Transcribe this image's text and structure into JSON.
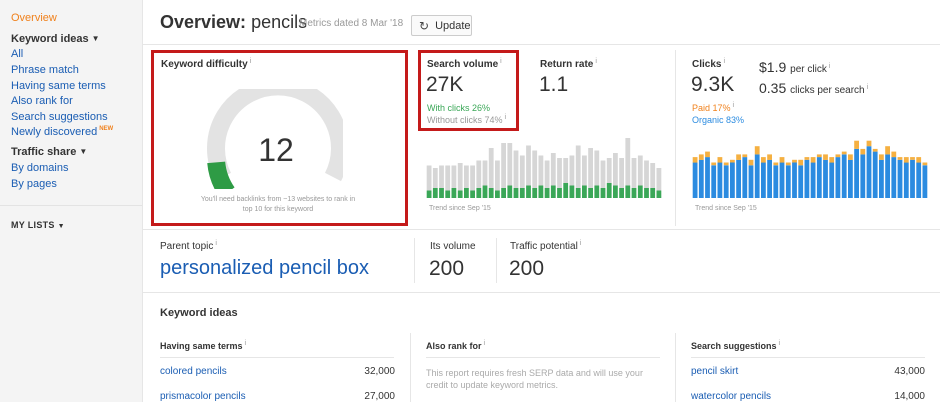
{
  "sidebar": {
    "overview": "Overview",
    "keyword_ideas": "Keyword ideas",
    "links": [
      "All",
      "Phrase match",
      "Having same terms",
      "Also rank for",
      "Search suggestions",
      "Newly discovered"
    ],
    "new_badge": "NEW",
    "traffic_share": "Traffic share",
    "traffic_links": [
      "By domains",
      "By pages"
    ],
    "my_lists": "MY LISTS"
  },
  "header": {
    "title": "Overview:",
    "keyword": "pencils",
    "metrics_date": "Metrics dated 8 Mar '18",
    "update_label": "Update"
  },
  "difficulty": {
    "label": "Keyword difficulty",
    "value": "12",
    "level": 0.12,
    "note": "You'll need backlinks from ~13 websites to rank in top 10 for this keyword"
  },
  "volume": {
    "label": "Search volume",
    "value": "27K",
    "with_clicks": "With clicks 26%",
    "without_clicks": "Without clicks 74%",
    "trend": "Trend since Sep '15"
  },
  "return_rate": {
    "label": "Return rate",
    "value": "1.1"
  },
  "clicks": {
    "label": "Clicks",
    "value": "9.3K",
    "paid": "Paid 17%",
    "organic": "Organic 83%",
    "cpc_value": "$1.9",
    "cpc_unit": "per click",
    "cps_value": "0.35",
    "cps_unit": "clicks per search",
    "trend": "Trend since Sep '15"
  },
  "parent_topic": {
    "label": "Parent topic",
    "value": "personalized pencil box",
    "its_volume_label": "Its volume",
    "its_volume": "200",
    "traffic_potential_label": "Traffic potential",
    "traffic_potential": "200"
  },
  "keyword_ideas": {
    "title": "Keyword ideas",
    "same_terms": {
      "head": "Having same terms",
      "rows": [
        {
          "kw": "colored pencils",
          "vol": "32,000"
        },
        {
          "kw": "prismacolor pencils",
          "vol": "27,000"
        }
      ]
    },
    "also_rank": {
      "head": "Also rank for",
      "note": "This report requires fresh SERP data and will use your credit to update keyword metrics."
    },
    "suggestions": {
      "head": "Search suggestions",
      "rows": [
        {
          "kw": "pencil skirt",
          "vol": "43,000"
        },
        {
          "kw": "watercolor pencils",
          "vol": "14,000"
        }
      ]
    }
  },
  "colors": {
    "accent": "#f0811c",
    "link": "#1a5db3",
    "green": "#3aa757",
    "grey_bar": "#d6d6d6",
    "blue_bar": "#2b8be0",
    "orange_bar": "#f5b041",
    "highlight": "#c41a1a"
  },
  "chart_data": [
    {
      "type": "bar",
      "name": "search-volume-trend",
      "series": [
        {
          "name": "With clicks",
          "values": [
            3,
            4,
            4,
            3,
            4,
            3,
            4,
            3,
            4,
            5,
            4,
            3,
            4,
            5,
            4,
            4,
            5,
            4,
            5,
            4,
            5,
            4,
            6,
            5,
            4,
            5,
            4,
            5,
            4,
            6,
            5,
            4,
            5,
            4,
            5,
            4,
            4,
            3
          ]
        },
        {
          "name": "Without clicks",
          "values": [
            10,
            8,
            9,
            10,
            9,
            11,
            9,
            10,
            11,
            10,
            16,
            12,
            18,
            17,
            15,
            13,
            16,
            15,
            12,
            11,
            13,
            12,
            10,
            12,
            17,
            12,
            16,
            14,
            11,
            10,
            13,
            12,
            19,
            12,
            12,
            11,
            10,
            9
          ]
        }
      ]
    },
    {
      "type": "bar",
      "name": "clicks-trend",
      "series": [
        {
          "name": "Organic",
          "values": [
            13,
            14,
            15,
            12,
            13,
            12,
            13,
            14,
            15,
            12,
            16,
            13,
            14,
            12,
            13,
            12,
            13,
            12,
            14,
            13,
            15,
            14,
            13,
            15,
            16,
            14,
            18,
            16,
            19,
            17,
            14,
            16,
            15,
            14,
            13,
            14,
            13,
            12
          ]
        },
        {
          "name": "Paid",
          "values": [
            2,
            2,
            2,
            1,
            2,
            1,
            1,
            2,
            1,
            2,
            3,
            2,
            2,
            1,
            2,
            1,
            1,
            2,
            1,
            2,
            1,
            2,
            2,
            1,
            1,
            2,
            3,
            2,
            2,
            1,
            2,
            3,
            2,
            1,
            2,
            1,
            2,
            1
          ]
        }
      ]
    }
  ]
}
